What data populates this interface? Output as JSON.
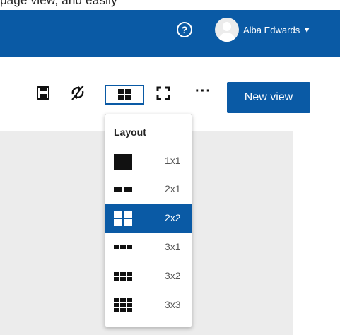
{
  "top_strip_text": "page view, and easily",
  "header": {
    "help_icon": "question-circle-icon",
    "help_glyph": "?",
    "user_name": "Alba Edwards",
    "caret": "▼"
  },
  "toolbar": {
    "save_icon": "save-icon",
    "refresh_icon": "refresh-off-icon",
    "layout_icon": "grid-2x2-icon",
    "fullscreen_icon": "fullscreen-icon",
    "more_label": "···",
    "new_view_label": "New view"
  },
  "layout_menu": {
    "title": "Layout",
    "selected": "2x2",
    "options": [
      {
        "label": "1x1"
      },
      {
        "label": "2x1"
      },
      {
        "label": "2x2"
      },
      {
        "label": "3x1"
      },
      {
        "label": "3x2"
      },
      {
        "label": "3x3"
      }
    ]
  },
  "colors": {
    "brand_blue": "#0a5aa5",
    "canvas_gray": "#ececec",
    "menu_text": "#555555"
  }
}
